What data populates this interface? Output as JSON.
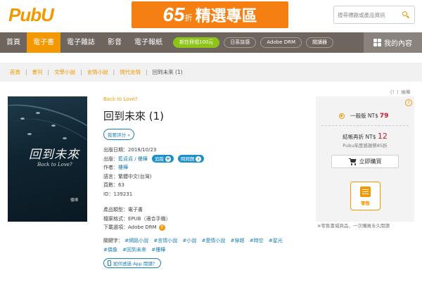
{
  "header": {
    "logo": "PubU",
    "banner": {
      "number": "65",
      "unit": "折",
      "text": "精選專區"
    },
    "search_placeholder": "搜尋標題或產品資訊",
    "brand_color": "#f39800"
  },
  "nav": {
    "items": [
      {
        "label": "首頁"
      },
      {
        "label": "電子書",
        "active": true
      },
      {
        "label": "電子雜誌"
      },
      {
        "label": "影音"
      },
      {
        "label": "電子報紙"
      }
    ],
    "pills": [
      "新註冊領100元",
      "日系誌感",
      "Adobe DRM",
      "閱讀器"
    ],
    "my_content": "我的內容"
  },
  "breadcrumb": [
    "首頁",
    "書刊",
    "文學小說",
    "言情小說",
    "現代言情",
    "回到未來 (1)"
  ],
  "cover": {
    "title": "回到未來",
    "subtitle": "Back to Love?",
    "author": "樓樺"
  },
  "book": {
    "subtitle": "Back to Love?",
    "title": "回到未來 (1)",
    "rate_button": "我要評分 »",
    "publish_date": {
      "label": "出版日期：",
      "value": "2018/10/23"
    },
    "publisher": {
      "label": "出版：",
      "value": "藍貞貞 / 樓樺",
      "follow": "追蹤",
      "ask": "問問題"
    },
    "author": {
      "label": "作者：",
      "value": "樓樺"
    },
    "language": {
      "label": "語言：",
      "value": "繁體中文(台灣)"
    },
    "pages": {
      "label": "頁數：",
      "value": "63"
    },
    "id": {
      "label": "ID：",
      "value": "139231"
    },
    "product_type": {
      "label": "產品類型：",
      "value": "電子書"
    },
    "file_format": {
      "label": "檔案格式：",
      "value": "EPUB（適合手機）"
    },
    "download": {
      "label": "下載選項：",
      "value": "Adobe DRM"
    },
    "tags_label": "關鍵字：",
    "tags": [
      "#網路小說",
      "#言情小說",
      "#小說",
      "#愛情小說",
      "#穿越",
      "#時空",
      "#星光",
      "#偶像",
      "#回到未來",
      "#樓樺"
    ],
    "app_button": "如何透過 App 閱讀？"
  },
  "purchase": {
    "report": "（！）檢舉",
    "help": "?",
    "option_label": "一般版",
    "currency": "NT$",
    "price": "79",
    "combo_label": "結帳再折",
    "combo_price": "12",
    "combo_note": "Pubu年度感謝祭85折",
    "buy_button": "立即購買",
    "retail_label": "零售",
    "footnote": "※零售書城商品，一次購買永久閱讀",
    "price_color": "#d0102a"
  }
}
